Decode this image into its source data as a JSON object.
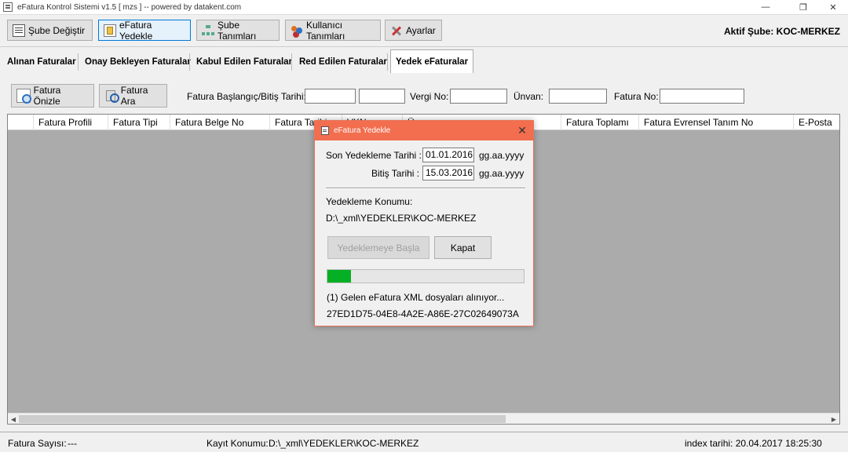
{
  "window": {
    "title": "eFatura Kontrol Sistemi v1.5 [ mzs ]  -- powered by datakent.com",
    "min_glyph": "—",
    "restore_glyph": "❐",
    "close_glyph": "✕"
  },
  "toolbar": {
    "buttons": [
      {
        "label": "Şube Değiştir",
        "icon": "switch-icon"
      },
      {
        "label": "eFatura Yedekle",
        "icon": "backup-icon"
      },
      {
        "label": "Şube Tanımları",
        "icon": "branch-icon"
      },
      {
        "label": "Kullanıcı Tanımları",
        "icon": "users-icon"
      },
      {
        "label": "Ayarlar",
        "icon": "settings-icon"
      }
    ],
    "active_branch": "Aktif Şube: KOC-MERKEZ"
  },
  "tabs": [
    {
      "label": "Alınan Faturalar"
    },
    {
      "label": "Onay Bekleyen Faturalar"
    },
    {
      "label": "Kabul Edilen Faturalar"
    },
    {
      "label": "Red Edilen Faturalar"
    },
    {
      "label": "Yedek eFaturalar",
      "selected": true
    }
  ],
  "filters": {
    "preview_button": "Fatura Önizle",
    "search_button": "Fatura Ara",
    "date_range_label": "Fatura Başlangıç/Bitiş Tarihi:",
    "tax_no_label": "Vergi No:",
    "title_label": "Ünvan:",
    "invoice_no_label": "Fatura No:",
    "start_date": "",
    "end_date": "",
    "tax_no": "",
    "title": "",
    "invoice_no": ""
  },
  "grid": {
    "columns": [
      "",
      "Fatura Profili",
      "Fatura Tipi",
      "Fatura Belge No",
      "Fatura Tarihi",
      "VKN",
      "Ünvan",
      "Fatura Toplamı",
      "Fatura Evrensel Tanım No",
      "E-Posta"
    ],
    "scroll_left": "◀",
    "scroll_right": "▶"
  },
  "status": {
    "count_label": "Fatura Sayısı:",
    "count_value": "---",
    "location_label": "Kayıt Konumu:",
    "location_value": "D:\\_xml\\YEDEKLER\\KOC-MERKEZ",
    "index_date": "index tarihi: 20.04.2017 18:25:30"
  },
  "dialog": {
    "title": "eFatura Yedekle",
    "close_glyph": "✕",
    "last_backup_label": "Son Yedekleme Tarihi :",
    "last_backup_value": "01.01.2016",
    "end_date_label": "Bitiş Tarihi :",
    "end_date_value": "15.03.2016",
    "date_format": "gg.aa.yyyy",
    "location_label": "Yedekleme Konumu:",
    "location_value": "D:\\_xml\\YEDEKLER\\KOC-MERKEZ",
    "start_button": "Yedeklemeye Başla",
    "close_button": "Kapat",
    "progress_percent": 12,
    "progress_color": "#06b025",
    "status_line": "(1) Gelen eFatura XML dosyaları alınıyor...",
    "current_id": "27ED1D75-04E8-4A2E-A86E-27C02649073A"
  },
  "colors": {
    "dialog_title_bg": "#f26e4f",
    "active_button_border": "#0078d7",
    "grid_bg": "#ababab"
  }
}
